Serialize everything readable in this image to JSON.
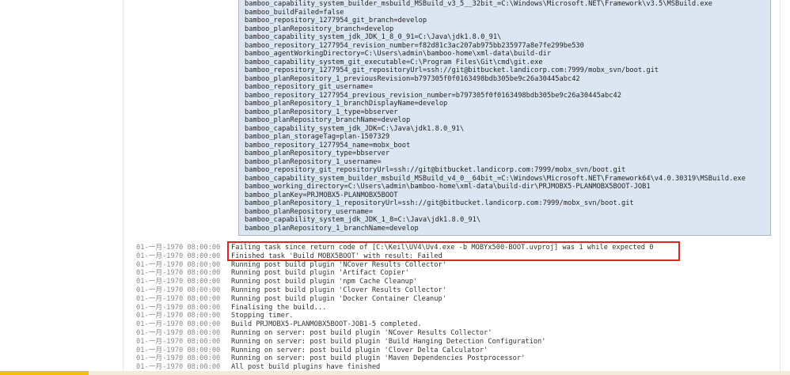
{
  "environment": {
    "lines": [
      "bamboo_capability_system_builder_msbuild_MSBuild_v3_5__32bit_=C:\\Windows\\Microsoft.NET\\Framework\\v3.5\\MSBuild.exe",
      "bamboo_buildFailed=false",
      "bamboo_repository_1277954_git_branch=develop",
      "bamboo_planRepository_branch=develop",
      "bamboo_capability_system_jdk_JDK_1_8_0_91=C:\\Java\\jdk1.8.0_91\\",
      "bamboo_repository_1277954_revision_number=f82d81c3ac207ab975bb235977a8e7fe299be530",
      "bamboo_agentWorkingDirectory=C:\\Users\\admin\\bamboo-home\\xml-data\\build-dir",
      "bamboo_capability_system_git_executable=C:\\Program Files\\Git\\cmd\\git.exe",
      "bamboo_repository_1277954_git_repositoryUrl=ssh://git@bitbucket.landicorp.com:7999/mobx_svn/boot.git",
      "bamboo_planRepository_1_previousRevision=b797305f0f0163498bdb305be9c26a30445abc42",
      "bamboo_repository_git_username=",
      "bamboo_repository_1277954_previous_revision_number=b797305f0f0163498bdb305be9c26a30445abc42",
      "bamboo_planRepository_1_branchDisplayName=develop",
      "bamboo_planRepository_1_type=bbserver",
      "bamboo_planRepository_branchName=develop",
      "bamboo_capability_system_jdk_JDK=C:\\Java\\jdk1.8.0_91\\",
      "bamboo_plan_storageTag=plan-1507329",
      "bamboo_repository_1277954_name=mobx_boot",
      "bamboo_planRepository_type=bbserver",
      "bamboo_planRepository_1_username=",
      "bamboo_repository_git_repositoryUrl=ssh://git@bitbucket.landicorp.com:7999/mobx_svn/boot.git",
      "bamboo_capability_system_builder_msbuild_MSBuild_v4_0__64bit_=C:\\Windows\\Microsoft.NET\\Framework64\\v4.0.30319\\MSBuild.exe",
      "bamboo_working_directory=C:\\Users\\admin\\bamboo-home\\xml-data\\build-dir\\PRJMOBX5-PLANMOBX5BOOT-JOB1",
      "bamboo_planKey=PRJMOBX5-PLANMOBX5BOOT",
      "bamboo_planRepository_1_repositoryUrl=ssh://git@bitbucket.landicorp.com:7999/mobx_svn/boot.git",
      "bamboo_planRepository_username=",
      "bamboo_capability_system_jdk_JDK_1_8=C:\\Java\\jdk1.8.0_91\\",
      "bamboo_planRepository_1_branchName=develop"
    ]
  },
  "log": [
    {
      "time": "01-一月-1970 08:00:00",
      "message": "Failing task since return code of [C:\\Keil\\UV4\\Uv4.exe -b MOBYx500-BOOT.uvproj] was 1 while expected 0"
    },
    {
      "time": "01-一月-1970 08:00:00",
      "message": "Finished task 'Build MOBX5BOOT' with result: Failed"
    },
    {
      "time": "01-一月-1970 08:00:00",
      "message": "Running post build plugin 'NCover Results Collector'"
    },
    {
      "time": "01-一月-1970 08:00:00",
      "message": "Running post build plugin 'Artifact Copier'"
    },
    {
      "time": "01-一月-1970 08:00:00",
      "message": "Running post build plugin 'npm Cache Cleanup'"
    },
    {
      "time": "01-一月-1970 08:00:00",
      "message": "Running post build plugin 'Clover Results Collector'"
    },
    {
      "time": "01-一月-1970 08:00:00",
      "message": "Running post build plugin 'Docker Container Cleanup'"
    },
    {
      "time": "01-一月-1970 08:00:00",
      "message": "Finalising the build..."
    },
    {
      "time": "01-一月-1970 08:00:00",
      "message": "Stopping timer."
    },
    {
      "time": "01-一月-1970 08:00:00",
      "message": "Build PRJMOBX5-PLANMOBX5BOOT-JOB1-5 completed."
    },
    {
      "time": "01-一月-1970 08:00:00",
      "message": "Running on server: post build plugin 'NCover Results Collector'"
    },
    {
      "time": "01-一月-1970 08:00:00",
      "message": "Running on server: post build plugin 'Build Hanging Detection Configuration'"
    },
    {
      "time": "01-一月-1970 08:00:00",
      "message": "Running on server: post build plugin 'Clover Delta Calculator'"
    },
    {
      "time": "01-一月-1970 08:00:00",
      "message": "Running on server: post build plugin 'Maven Dependencies Postprocessor'"
    },
    {
      "time": "01-一月-1970 08:00:00",
      "message": "All post build plugins have finished"
    }
  ],
  "highlight": {
    "color": "#e0241f",
    "rows": [
      0,
      1
    ]
  }
}
